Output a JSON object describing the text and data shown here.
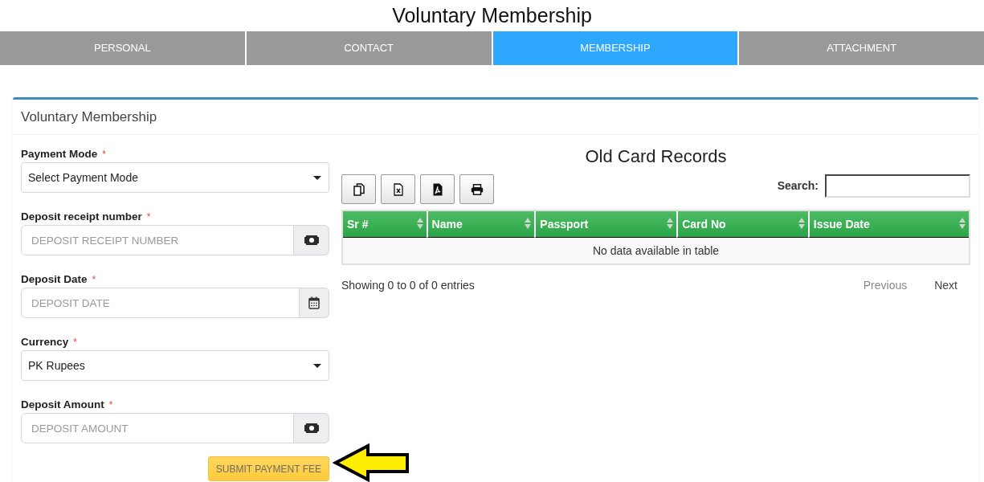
{
  "page_title": "Voluntary Membership",
  "tabs": [
    {
      "label": "PERSONAL",
      "selected": false
    },
    {
      "label": "CONTACT",
      "selected": false
    },
    {
      "label": "MEMBERSHIP",
      "selected": true
    },
    {
      "label": "ATTACHMENT",
      "selected": false
    }
  ],
  "panel": {
    "title": "Voluntary Membership",
    "form": {
      "fields": [
        {
          "kind": "select",
          "label": "Payment Mode",
          "required_mark": "*",
          "value": "Select Payment Mode"
        },
        {
          "kind": "cash",
          "label": "Deposit receipt number",
          "required_mark": "*",
          "placeholder": "DEPOSIT RECEIPT NUMBER"
        },
        {
          "kind": "date",
          "label": "Deposit Date",
          "required_mark": "*",
          "placeholder": "DEPOSIT DATE"
        },
        {
          "kind": "select",
          "label": "Currency",
          "required_mark": "*",
          "value": "PK Rupees"
        },
        {
          "kind": "cash",
          "label": "Deposit Amount",
          "required_mark": "*",
          "placeholder": "DEPOSIT AMOUNT"
        }
      ],
      "submit_label": "SUBMIT PAYMENT FEE"
    },
    "records": {
      "title": "Old Card Records",
      "export_buttons": [
        {
          "kind": "copy"
        },
        {
          "kind": "excel"
        },
        {
          "kind": "pdf"
        },
        {
          "kind": "print"
        }
      ],
      "search_label": "Search:",
      "columns": [
        "Sr #",
        "Name",
        "Passport",
        "Card No",
        "Issue Date"
      ],
      "empty_message": "No data available in table",
      "info": "Showing 0 to 0 of 0 entries",
      "pagination": [
        {
          "label": "Previous",
          "disabled": true
        },
        {
          "label": "Next",
          "disabled": false
        }
      ]
    }
  }
}
